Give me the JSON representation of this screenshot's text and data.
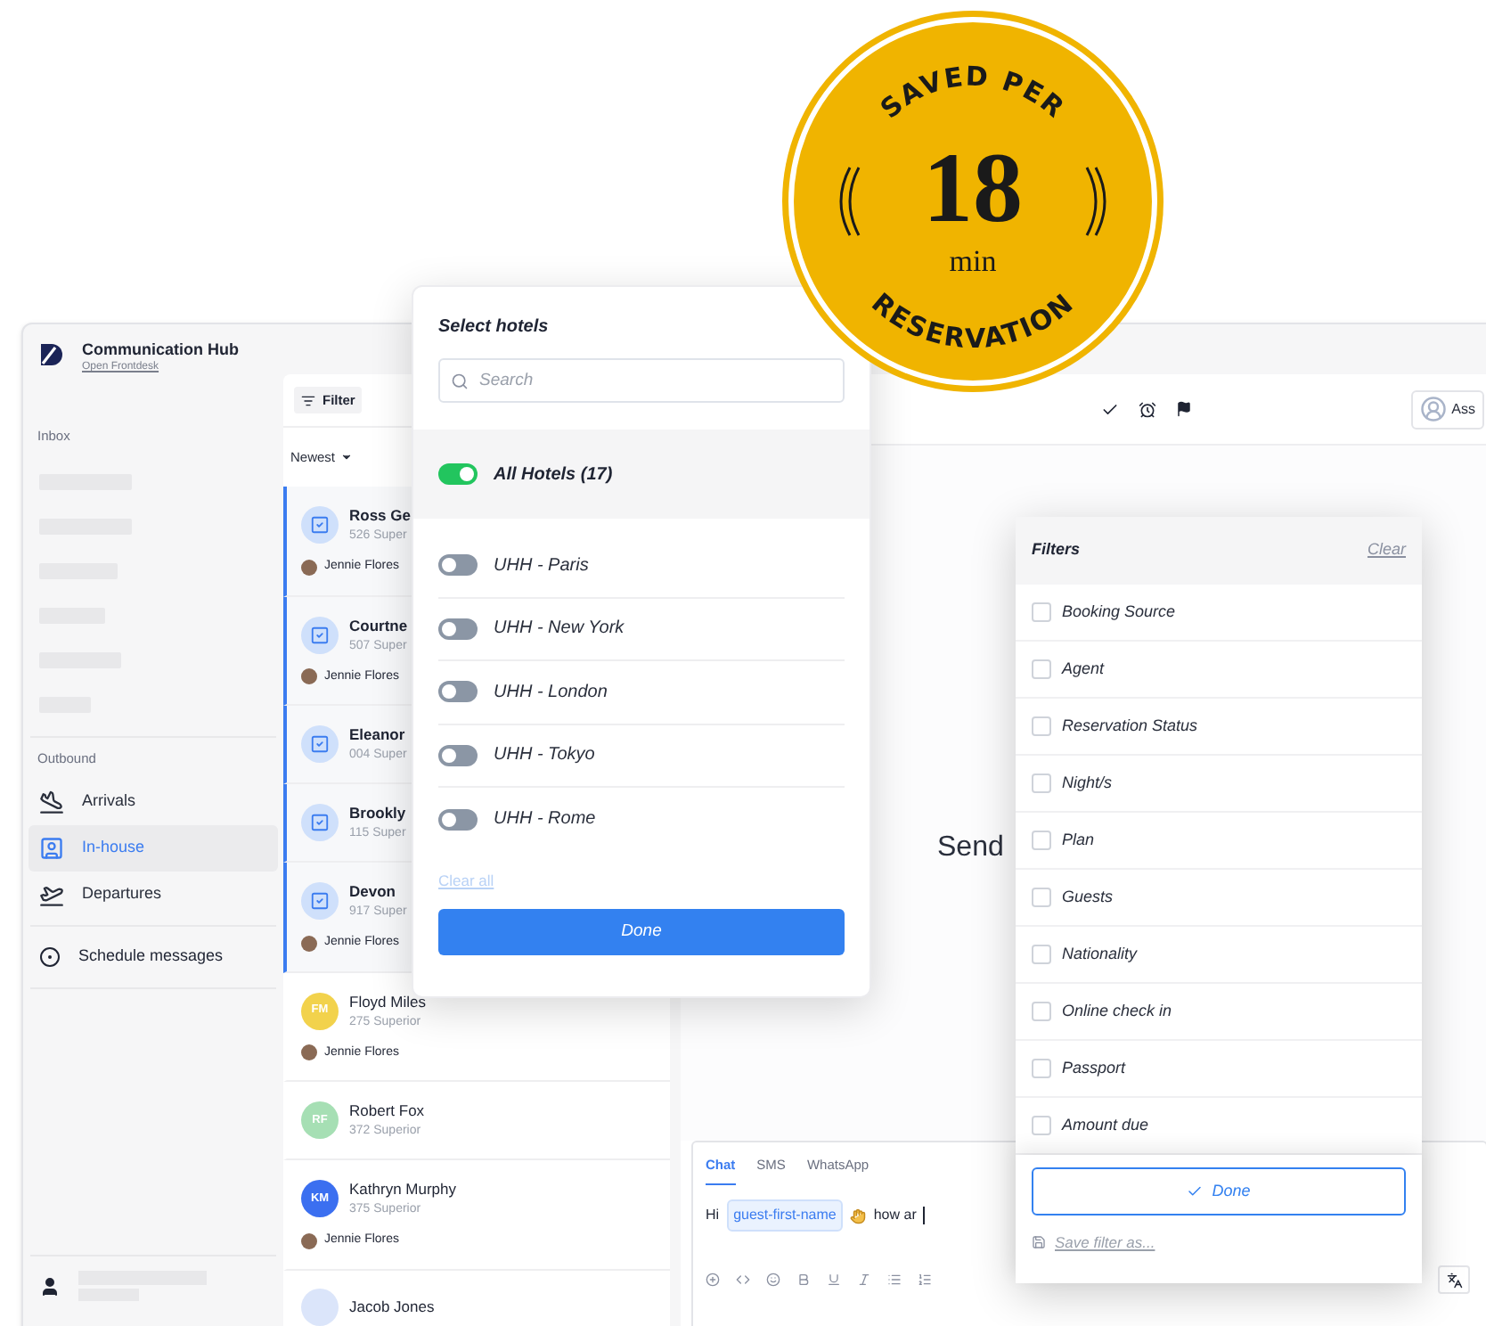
{
  "app": {
    "title": "Communication Hub",
    "subtitle": "Open Frontdesk"
  },
  "sidebar": {
    "inbox_label": "Inbox",
    "outbound_label": "Outbound",
    "items": [
      {
        "label": "Arrivals",
        "selected": false
      },
      {
        "label": "In-house",
        "selected": true
      },
      {
        "label": "Departures",
        "selected": false
      }
    ],
    "schedule": {
      "label": "Schedule messages"
    }
  },
  "conversation_list": {
    "filter_button": "Filter",
    "sort": "Newest",
    "items": [
      {
        "name": "Ross Ge",
        "room": "526 Super",
        "agent": "Jennie Flores",
        "selected": true,
        "kind": "check"
      },
      {
        "name": "Courtne",
        "room": "507 Super",
        "agent": "Jennie Flores",
        "selected": true,
        "kind": "check"
      },
      {
        "name": "Eleanor",
        "room": "004 Super",
        "selected": true,
        "kind": "check"
      },
      {
        "name": "Brookly",
        "room": "115 Super",
        "selected": true,
        "kind": "check"
      },
      {
        "name": "Devon",
        "room": "917 Super",
        "agent": "Jennie Flores",
        "selected": true,
        "kind": "check"
      },
      {
        "name": "Floyd Miles",
        "room": "275 Superior",
        "agent": "Jennie Flores",
        "selected": false,
        "kind": "initials",
        "initials": "FM",
        "color": "#f2d24c"
      },
      {
        "name": "Robert Fox",
        "room": "372 Superior",
        "selected": false,
        "kind": "initials",
        "initials": "RF",
        "color": "#a6dfb4"
      },
      {
        "name": "Kathryn Murphy",
        "room": "375 Superior",
        "agent": "Jennie Flores",
        "selected": false,
        "kind": "initials",
        "initials": "KM",
        "color": "#3b6ff0"
      },
      {
        "name": "Jacob Jones",
        "selected": false,
        "kind": "initials",
        "color": "#dbe5fa"
      }
    ]
  },
  "toolbar": {
    "assign_button": "Ass"
  },
  "main": {
    "empty_text": "Send"
  },
  "composer": {
    "tabs": [
      {
        "label": "Chat",
        "selected": true
      },
      {
        "label": "SMS",
        "selected": false
      },
      {
        "label": "WhatsApp",
        "selected": false
      }
    ],
    "message": {
      "before": "Hi",
      "variable": "guest-first-name",
      "after": "how ar"
    }
  },
  "hotel_picker": {
    "title": "Select hotels",
    "search_placeholder": "Search",
    "all": {
      "label": "All Hotels (17)",
      "on": true
    },
    "hotels": [
      {
        "label": "UHH - Paris",
        "on": false
      },
      {
        "label": "UHH - New York",
        "on": false
      },
      {
        "label": "UHH - London",
        "on": false
      },
      {
        "label": "UHH - Tokyo",
        "on": false
      },
      {
        "label": "UHH - Rome",
        "on": false
      }
    ],
    "clear_link": "Clear all",
    "done_button": "Done"
  },
  "filters": {
    "title": "Filters",
    "clear_link": "Clear",
    "options": [
      {
        "label": "Booking Source",
        "checked": false
      },
      {
        "label": "Agent",
        "checked": false
      },
      {
        "label": "Reservation Status",
        "checked": false
      },
      {
        "label": "Night/s",
        "checked": false
      },
      {
        "label": "Plan",
        "checked": false
      },
      {
        "label": "Guests",
        "checked": false
      },
      {
        "label": "Nationality",
        "checked": false
      },
      {
        "label": "Online check in",
        "checked": false
      },
      {
        "label": "Passport",
        "checked": false
      },
      {
        "label": "Amount due",
        "checked": false
      }
    ],
    "done_button": "Done",
    "save_link": "Save filter as..."
  },
  "badge": {
    "top": "SAVED PER",
    "value": "18",
    "unit": "min",
    "bottom": "RESERVATION"
  }
}
